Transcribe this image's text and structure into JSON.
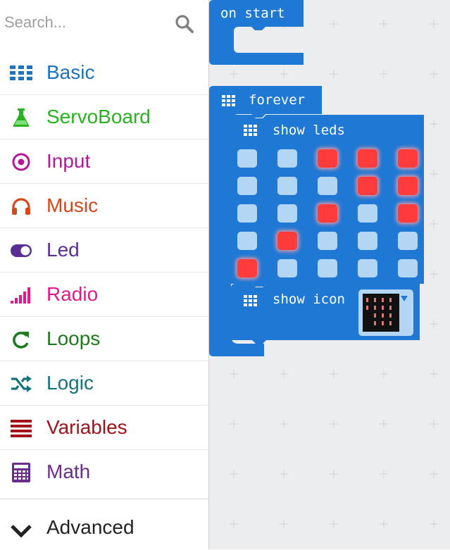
{
  "search": {
    "placeholder": "Search..."
  },
  "categories": [
    {
      "label": "Basic",
      "icon": "grid-icon",
      "color": "#1e73be"
    },
    {
      "label": "ServoBoard",
      "icon": "flask-icon",
      "color": "#28b320"
    },
    {
      "label": "Input",
      "icon": "target-icon",
      "color": "#b8179c"
    },
    {
      "label": "Music",
      "icon": "headphones-icon",
      "color": "#d9461b"
    },
    {
      "label": "Led",
      "icon": "toggle-icon",
      "color": "#5b2e94"
    },
    {
      "label": "Radio",
      "icon": "signal-bars-icon",
      "color": "#e3198b"
    },
    {
      "label": "Loops",
      "icon": "refresh-icon",
      "color": "#1f7a1f"
    },
    {
      "label": "Logic",
      "icon": "shuffle-icon",
      "color": "#17727c"
    },
    {
      "label": "Variables",
      "icon": "bars-icon",
      "color": "#a1121a"
    },
    {
      "label": "Math",
      "icon": "calculator-icon",
      "color": "#6a2d8a"
    }
  ],
  "advanced": {
    "label": "Advanced",
    "icon": "chevron-down-icon",
    "color": "#222222"
  },
  "blocks": {
    "color": "#1e78d4",
    "on_start": {
      "label": "on start"
    },
    "forever": {
      "label": "forever"
    },
    "show_leds": {
      "label": "show leds",
      "leds": [
        [
          0,
          0,
          1,
          1,
          1
        ],
        [
          0,
          0,
          0,
          1,
          1
        ],
        [
          0,
          0,
          1,
          0,
          1
        ],
        [
          0,
          1,
          0,
          0,
          0
        ],
        [
          1,
          0,
          0,
          0,
          0
        ]
      ]
    },
    "show_icon": {
      "label": "show icon"
    }
  }
}
